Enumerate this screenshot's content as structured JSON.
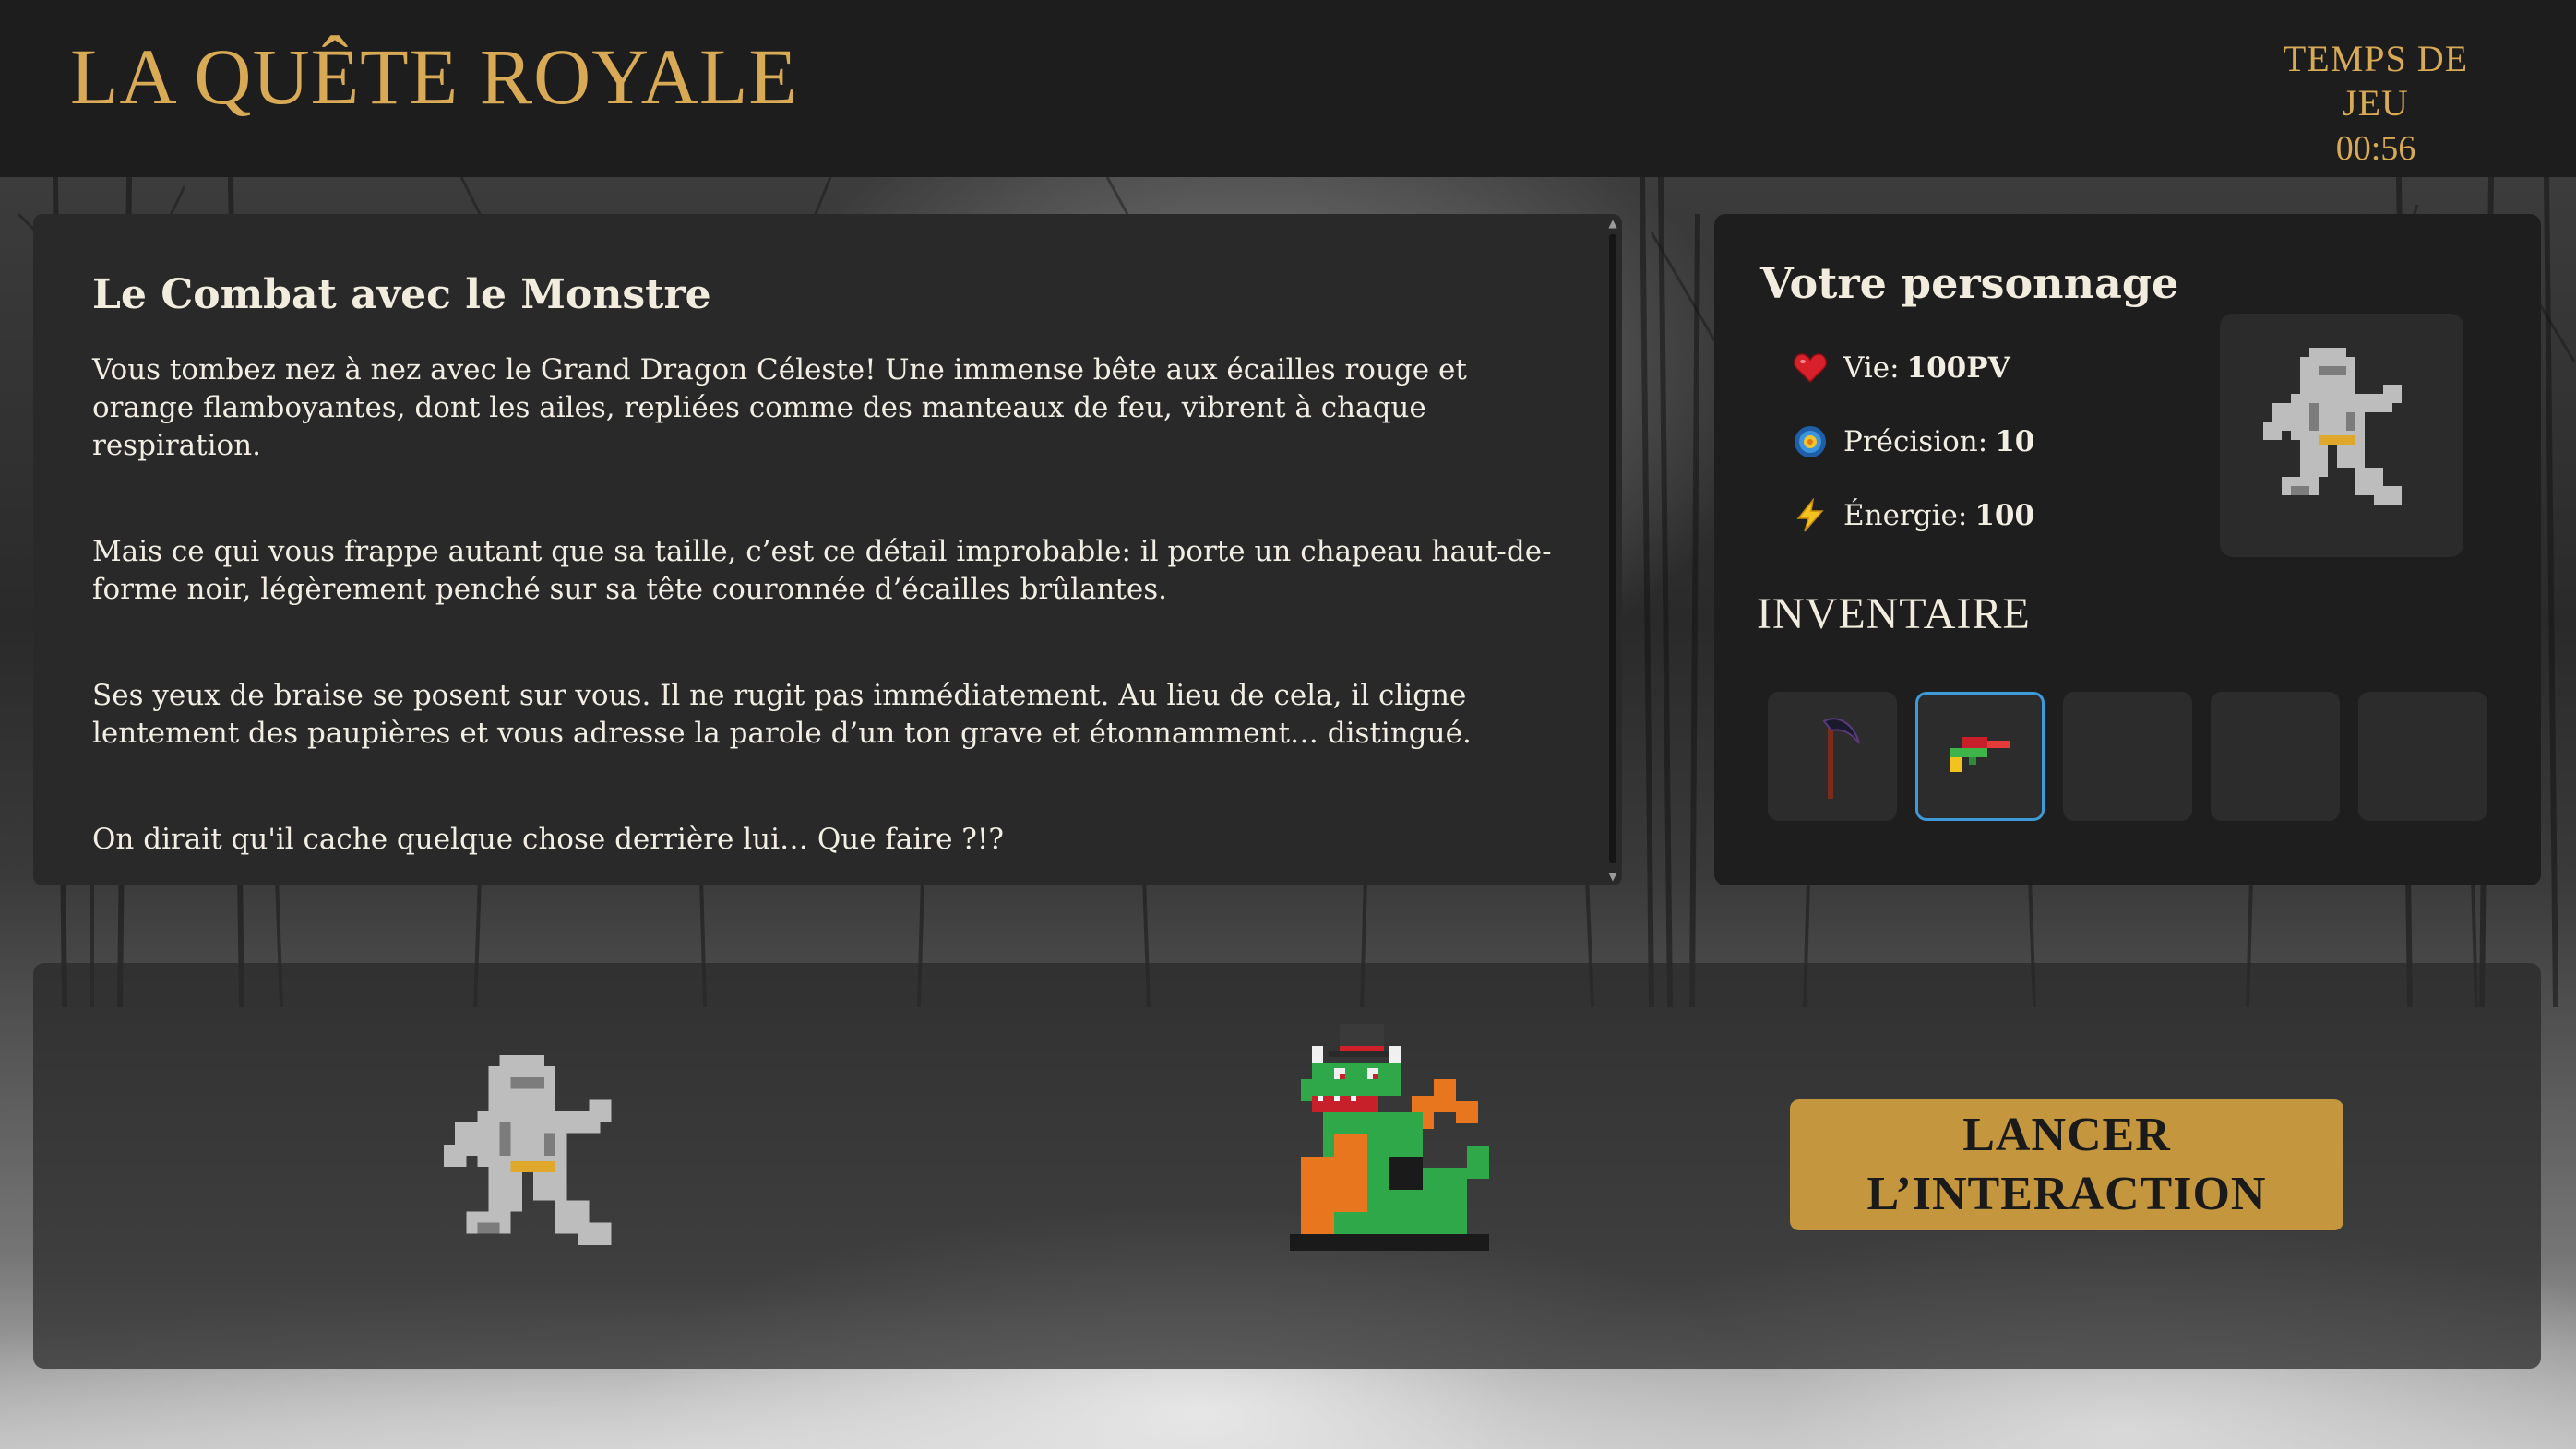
{
  "header": {
    "title": "LA QUÊTE ROYALE",
    "timer_label": "TEMPS DE JEU",
    "timer_value": "00:56"
  },
  "story": {
    "title": "Le Combat avec le Monstre",
    "paragraphs": [
      "Vous tombez nez à nez avec le Grand Dragon Céleste! Une immense bête aux écailles rouge et orange flamboyantes, dont les ailes, repliées comme des manteaux de feu, vibrent à chaque respiration.",
      "Mais ce qui vous frappe autant que sa taille, c’est ce détail improbable: il porte un chapeau haut-de-forme noir, légèrement penché sur sa tête couronnée d’écailles brûlantes.",
      "Ses yeux de braise se posent sur vous. Il ne rugit pas immédiatement. Au lieu de cela, il cligne lentement des paupières et vous adresse la parole d’un ton grave et étonnamment… distingué.",
      "On dirait qu'il cache quelque chose derrière lui… Que faire ?!?"
    ]
  },
  "character": {
    "title": "Votre personnage",
    "stats": [
      {
        "icon": "heart-icon",
        "label": "Vie:",
        "value": "100PV"
      },
      {
        "icon": "target-icon",
        "label": "Précision:",
        "value": "10"
      },
      {
        "icon": "lightning-icon",
        "label": "Énergie:",
        "value": "100"
      }
    ],
    "inventory_title": "INVENTAIRE",
    "inventory": [
      {
        "item": "scythe-icon",
        "selected": false
      },
      {
        "item": "water-gun-icon",
        "selected": true
      },
      {
        "item": "",
        "selected": false
      },
      {
        "item": "",
        "selected": false
      },
      {
        "item": "",
        "selected": false
      }
    ]
  },
  "battle": {
    "action_line1": "LANCER",
    "action_line2": "L’INTERACTION"
  },
  "colors": {
    "gold": "#d9aa56",
    "button": "#c4963e",
    "panel": "#292929",
    "selected_border": "#3f9ad8"
  }
}
